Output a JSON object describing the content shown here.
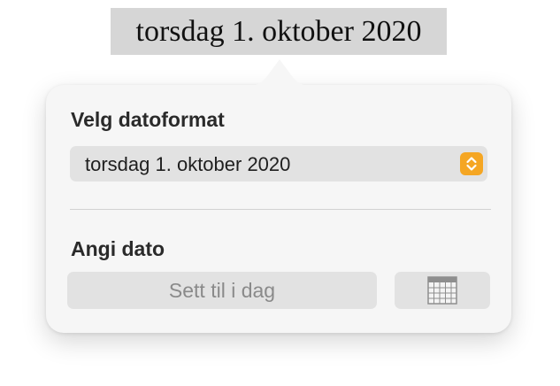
{
  "document": {
    "date_text": "torsdag 1. oktober 2020"
  },
  "popover": {
    "format_label": "Velg datoformat",
    "format_selected": "torsdag 1. oktober 2020",
    "set_date_label": "Angi dato",
    "today_button_label": "Sett til i dag",
    "calendar_icon": "calendar-icon",
    "stepper_icon": "chevron-up-down-icon",
    "accent_color": "#f5a623"
  }
}
